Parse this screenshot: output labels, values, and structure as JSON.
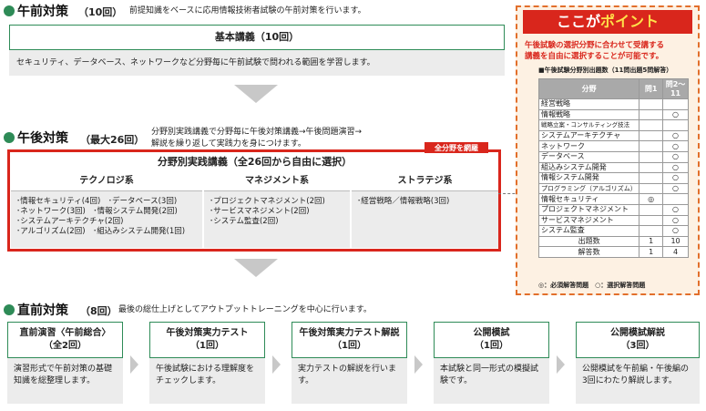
{
  "am": {
    "title": "午前対策",
    "count": "（10回）",
    "desc": "前提知識をベースに応用情報技術者試験の午前対策を行います。",
    "course_title": "基本講義（10回）",
    "course_desc": "セキュリティ、データベース、ネットワークなど分野毎に午前試験で問われる範囲を学習します。"
  },
  "pm": {
    "title": "午後対策",
    "count": "（最大26回）",
    "desc_line1": "分野別実践講義で分野毎に午後対策講義→午後問題演習→",
    "desc_line2": "解説を繰り返して実践力を身につけます。",
    "badge": "全分野を網羅",
    "course_title": "分野別実践講義（全26回から自由に選択）",
    "columns": [
      {
        "head": "テクノロジ系",
        "lines": [
          "･情報セキュリティ(4回)　･データベース(3回)",
          "･ネットワーク(3回)　･情報システム開発(2回)",
          "･システムアーキテクチャ(2回)",
          "･アルゴリズム(2回)　･組込みシステム開発(1回)"
        ]
      },
      {
        "head": "マネジメント系",
        "lines": [
          "･プロジェクトマネジメント(2回)",
          "･サービスマネジメント(2回)",
          "･システム監査(2回)",
          ""
        ]
      },
      {
        "head": "ストラテジ系",
        "lines": [
          "･経営戦略／情報戦略(3回)",
          "",
          "",
          ""
        ]
      }
    ]
  },
  "final": {
    "title": "直前対策",
    "count": "（8回）",
    "desc": "最後の総仕上げとしてアウトプットトレーニングを中心に行います。",
    "steps": [
      {
        "title1": "直前演習〈午前総合〉",
        "title2": "（全2回）",
        "body": "演習形式で午前対策の基礎知識を総整理します。"
      },
      {
        "title1": "午後対策実力テスト",
        "title2": "（1回）",
        "body": "午後試験における理解度をチェックします。"
      },
      {
        "title1": "午後対策実力テスト解説",
        "title2": "（1回）",
        "body": "実力テストの解説を行います。"
      },
      {
        "title1": "公開模試",
        "title2": "（1回）",
        "body": "本試験と同一形式の模擬試験です。"
      },
      {
        "title1": "公開模試解説",
        "title2": "（3回）",
        "body": "公開模試を午前編・午後編の3回にわたり解説します。"
      }
    ]
  },
  "point": {
    "title_a": "ここが",
    "title_b": "ポイント",
    "text_line1": "午後試験の選択分野に合わせて受講する",
    "text_line2": "講義を自由に選択することが可能です。",
    "table_caption": "■午後試験分野別出題数（11問出題5問解答）",
    "headers": [
      "分野",
      "問1",
      "問2〜11"
    ],
    "rows": [
      {
        "name": "経営戦略",
        "q1": "",
        "q2": ""
      },
      {
        "name": "情報戦略",
        "q1": "",
        "q2": "○"
      },
      {
        "name": "戦略立案・コンサルティング技法",
        "q1": "",
        "q2": ""
      },
      {
        "name": "システムアーキテクチャ",
        "q1": "",
        "q2": "○"
      },
      {
        "name": "ネットワーク",
        "q1": "",
        "q2": "○"
      },
      {
        "name": "データベース",
        "q1": "",
        "q2": "○"
      },
      {
        "name": "組込みシステム開発",
        "q1": "",
        "q2": "○"
      },
      {
        "name": "情報システム開発",
        "q1": "",
        "q2": "○"
      },
      {
        "name": "プログラミング（アルゴリズム）",
        "q1": "",
        "q2": "○"
      },
      {
        "name": "情報セキュリティ",
        "q1": "◎",
        "q2": ""
      },
      {
        "name": "プロジェクトマネジメント",
        "q1": "",
        "q2": "○"
      },
      {
        "name": "サービスマネジメント",
        "q1": "",
        "q2": "○"
      },
      {
        "name": "システム監査",
        "q1": "",
        "q2": "○"
      }
    ],
    "totals": [
      {
        "name": "出題数",
        "q1": "1",
        "q2": "10"
      },
      {
        "name": "解答数",
        "q1": "1",
        "q2": "4"
      }
    ],
    "legend": "◎：必須解答問題　○：選択解答問題"
  }
}
